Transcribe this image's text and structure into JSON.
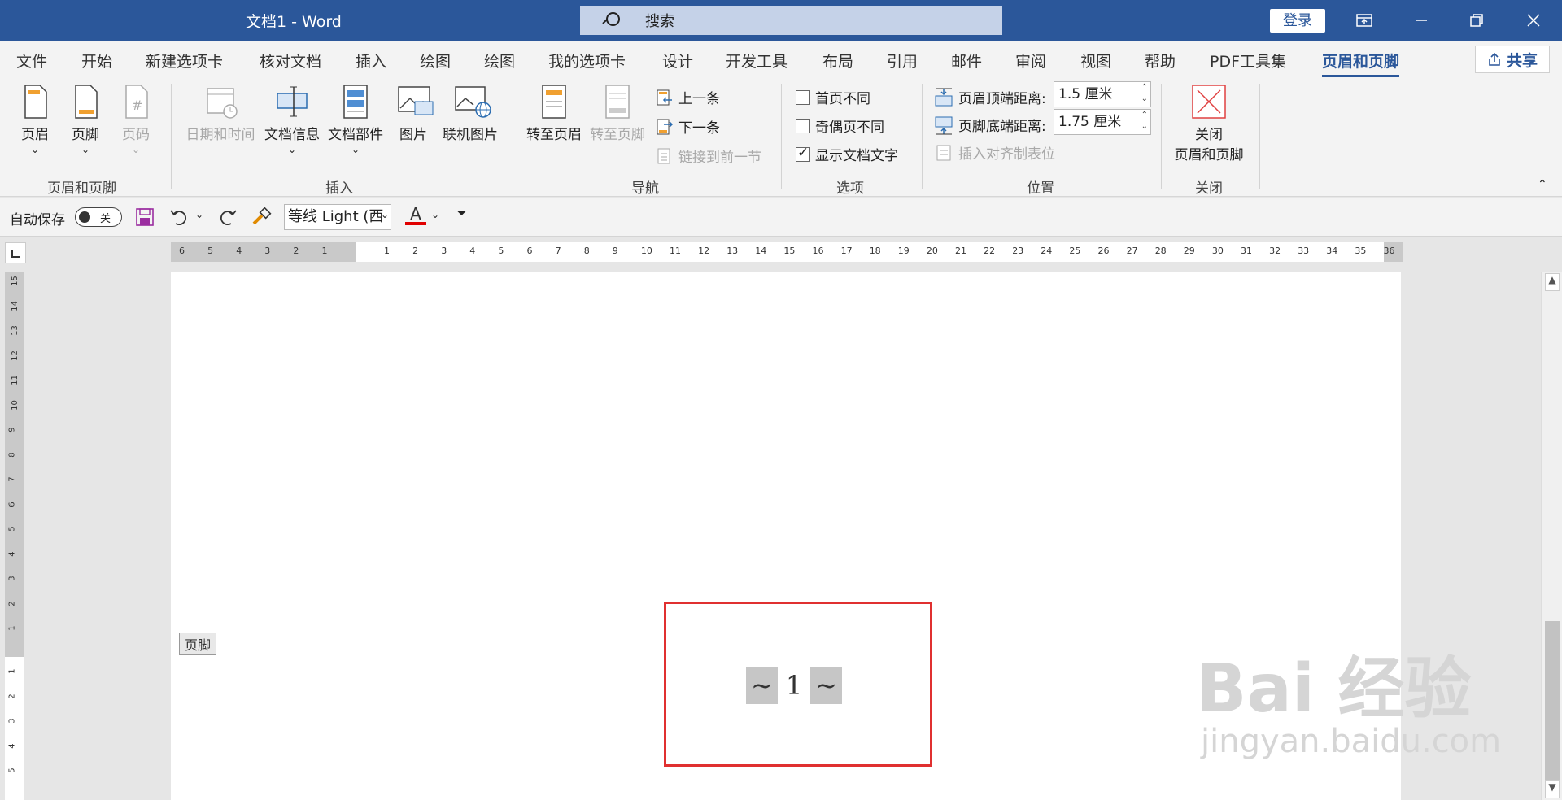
{
  "titlebar": {
    "title": "文档1  -  Word",
    "search_text": "搜索",
    "login": "登录"
  },
  "tabs": [
    {
      "label": "文件"
    },
    {
      "label": "开始"
    },
    {
      "label": "新建选项卡"
    },
    {
      "label": "核对文档"
    },
    {
      "label": "插入"
    },
    {
      "label": "绘图"
    },
    {
      "label": "绘图"
    },
    {
      "label": "我的选项卡"
    },
    {
      "label": "设计"
    },
    {
      "label": "开发工具"
    },
    {
      "label": "布局"
    },
    {
      "label": "引用"
    },
    {
      "label": "邮件"
    },
    {
      "label": "审阅"
    },
    {
      "label": "视图"
    },
    {
      "label": "帮助"
    },
    {
      "label": "PDF工具集"
    },
    {
      "label": "页眉和页脚"
    }
  ],
  "share": "共享",
  "ribbon": {
    "header": "页眉",
    "footer": "页脚",
    "page_number": "页码",
    "group_hf": "页眉和页脚",
    "datetime": "日期和时间",
    "docinfo": "文档信息",
    "docparts": "文档部件",
    "picture": "图片",
    "online_picture": "联机图片",
    "group_insert": "插入",
    "goto_header": "转至页眉",
    "goto_footer": "转至页脚",
    "prev": "上一条",
    "next": "下一条",
    "link_prev": "链接到前一节",
    "group_nav": "导航",
    "diff_first": "首页不同",
    "diff_odd_even": "奇偶页不同",
    "show_doc_text": "显示文档文字",
    "group_options": "选项",
    "header_top_label": "页眉顶端距离:",
    "header_top_value": "1.5 厘米",
    "footer_bottom_label": "页脚底端距离:",
    "footer_bottom_value": "1.75 厘米",
    "insert_align_tab": "插入对齐制表位",
    "group_position": "位置",
    "close_line1": "关闭",
    "close_line2": "页眉和页脚",
    "group_close": "关闭"
  },
  "qat": {
    "autosave": "自动保存",
    "toggle_state": "关",
    "font": "等线 Light (西"
  },
  "ruler": {
    "h_left": [
      "6",
      "5",
      "4",
      "3",
      "2",
      "1"
    ],
    "h_right": [
      "1",
      "2",
      "3",
      "4",
      "5",
      "6",
      "7",
      "8",
      "9",
      "10",
      "11",
      "12",
      "13",
      "14",
      "15",
      "16",
      "17",
      "18",
      "19",
      "20",
      "21",
      "22",
      "23",
      "24",
      "25",
      "26",
      "27",
      "28",
      "29",
      "30",
      "31",
      "32",
      "33",
      "34",
      "35",
      "36"
    ],
    "v_top": [
      "15",
      "14",
      "13",
      "12",
      "11",
      "10",
      "9",
      "8",
      "7",
      "6",
      "5",
      "4",
      "3",
      "2",
      "1"
    ],
    "v_bottom": [
      "1",
      "2",
      "3",
      "4",
      "5"
    ]
  },
  "document": {
    "footer_tag": "页脚",
    "page_left": "~",
    "page_number": "1",
    "page_right": "~"
  },
  "watermark": {
    "line1": "Bai 经验",
    "line2": "jingyan.baidu.com"
  },
  "colors": {
    "titlebar": "#2b579a",
    "highlight_box": "#e03030"
  }
}
